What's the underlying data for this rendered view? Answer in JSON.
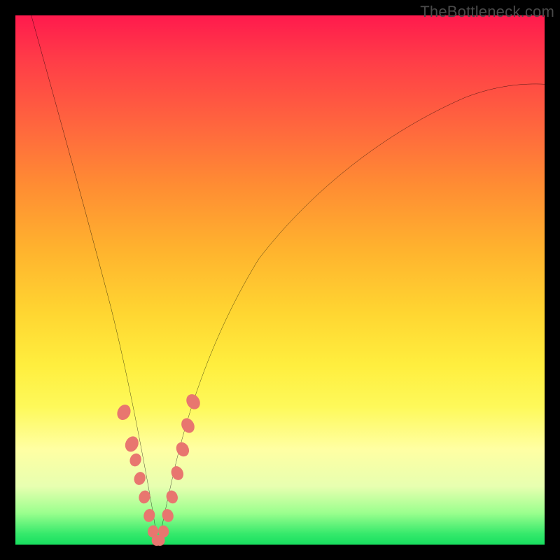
{
  "watermark": "TheBottleneck.com",
  "colors": {
    "curve_stroke": "#000000",
    "marker_fill": "#e8766f",
    "marker_stroke": "#e8766f",
    "gradient_top": "#ff1a4d",
    "gradient_bottom": "#18df5f"
  },
  "chart_data": {
    "type": "line",
    "title": "",
    "xlabel": "",
    "ylabel": "",
    "xlim": [
      0,
      100
    ],
    "ylim": [
      0,
      100
    ],
    "grid": false,
    "legend_position": "none",
    "series": [
      {
        "name": "left-branch",
        "x": [
          3,
          6,
          9,
          12,
          15,
          18,
          20,
          22,
          23.5,
          25,
          26,
          27
        ],
        "y": [
          100,
          82,
          67,
          54,
          43,
          33,
          26,
          18,
          12,
          6,
          2,
          0
        ]
      },
      {
        "name": "right-branch",
        "x": [
          27,
          28,
          29.5,
          31,
          33,
          36,
          40,
          46,
          54,
          64,
          76,
          90,
          100
        ],
        "y": [
          0,
          2,
          6,
          12,
          20,
          30,
          40,
          50,
          60,
          69,
          77,
          83,
          87
        ]
      }
    ],
    "markers": {
      "name": "highlighted-points",
      "x": [
        20.5,
        22.0,
        22.7,
        23.5,
        24.4,
        25.3,
        26.0,
        26.7,
        27.3,
        28.0,
        28.8,
        29.6,
        30.6,
        31.6,
        32.6,
        33.6
      ],
      "y": [
        25.0,
        19.0,
        16.0,
        12.5,
        9.0,
        5.5,
        2.5,
        0.8,
        0.8,
        2.5,
        5.5,
        9.0,
        13.5,
        18.0,
        22.5,
        27.0
      ]
    },
    "notes": "Background gradient encodes severity: red (top) = high, green (bottom) = low. V-shaped curve minimum near x≈27 at y≈0."
  }
}
